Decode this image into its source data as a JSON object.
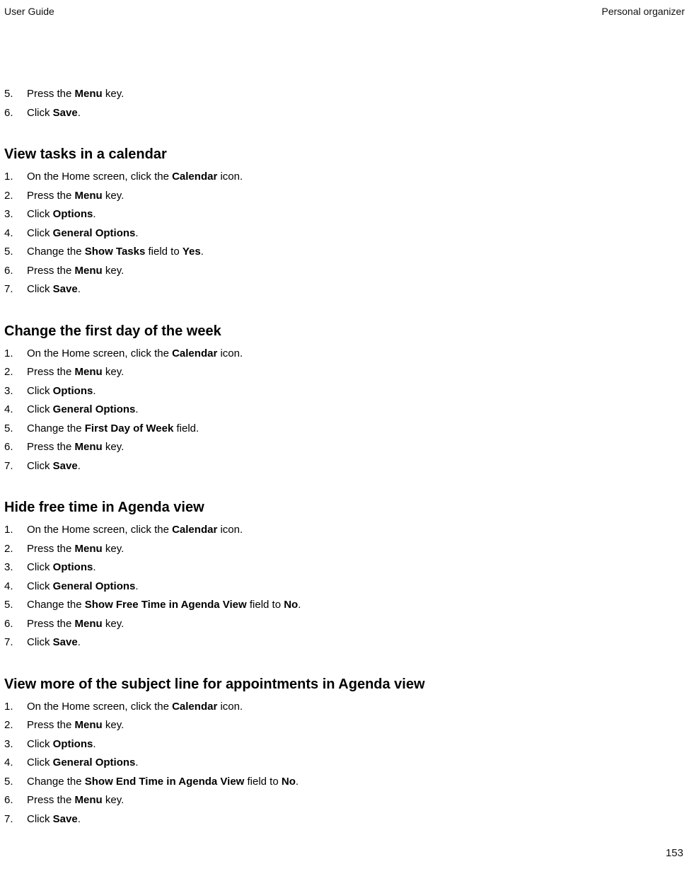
{
  "header": {
    "left": "User Guide",
    "right": "Personal organizer"
  },
  "intro_steps": [
    {
      "n": "5.",
      "parts": [
        {
          "t": "Press the "
        },
        {
          "b": "Menu"
        },
        {
          "t": " key."
        }
      ]
    },
    {
      "n": "6.",
      "parts": [
        {
          "t": "Click "
        },
        {
          "b": "Save"
        },
        {
          "t": "."
        }
      ]
    }
  ],
  "sections": [
    {
      "title": "View tasks in a calendar",
      "steps": [
        {
          "n": "1.",
          "parts": [
            {
              "t": "On the Home screen, click the "
            },
            {
              "b": "Calendar"
            },
            {
              "t": " icon."
            }
          ]
        },
        {
          "n": "2.",
          "parts": [
            {
              "t": "Press the "
            },
            {
              "b": "Menu"
            },
            {
              "t": " key."
            }
          ]
        },
        {
          "n": "3.",
          "parts": [
            {
              "t": "Click "
            },
            {
              "b": "Options"
            },
            {
              "t": "."
            }
          ]
        },
        {
          "n": "4.",
          "parts": [
            {
              "t": "Click "
            },
            {
              "b": "General Options"
            },
            {
              "t": "."
            }
          ]
        },
        {
          "n": "5.",
          "parts": [
            {
              "t": "Change the "
            },
            {
              "b": "Show Tasks"
            },
            {
              "t": " field to "
            },
            {
              "b": "Yes"
            },
            {
              "t": "."
            }
          ]
        },
        {
          "n": "6.",
          "parts": [
            {
              "t": "Press the "
            },
            {
              "b": "Menu"
            },
            {
              "t": " key."
            }
          ]
        },
        {
          "n": "7.",
          "parts": [
            {
              "t": "Click "
            },
            {
              "b": "Save"
            },
            {
              "t": "."
            }
          ]
        }
      ]
    },
    {
      "title": "Change the first day of the week",
      "steps": [
        {
          "n": "1.",
          "parts": [
            {
              "t": "On the Home screen, click the "
            },
            {
              "b": "Calendar"
            },
            {
              "t": " icon."
            }
          ]
        },
        {
          "n": "2.",
          "parts": [
            {
              "t": "Press the "
            },
            {
              "b": "Menu"
            },
            {
              "t": " key."
            }
          ]
        },
        {
          "n": "3.",
          "parts": [
            {
              "t": "Click "
            },
            {
              "b": "Options"
            },
            {
              "t": "."
            }
          ]
        },
        {
          "n": "4.",
          "parts": [
            {
              "t": "Click "
            },
            {
              "b": "General Options"
            },
            {
              "t": "."
            }
          ]
        },
        {
          "n": "5.",
          "parts": [
            {
              "t": "Change the "
            },
            {
              "b": "First Day of Week"
            },
            {
              "t": " field."
            }
          ]
        },
        {
          "n": "6.",
          "parts": [
            {
              "t": "Press the "
            },
            {
              "b": "Menu"
            },
            {
              "t": " key."
            }
          ]
        },
        {
          "n": "7.",
          "parts": [
            {
              "t": "Click "
            },
            {
              "b": "Save"
            },
            {
              "t": "."
            }
          ]
        }
      ]
    },
    {
      "title": "Hide free time in Agenda view",
      "steps": [
        {
          "n": "1.",
          "parts": [
            {
              "t": "On the Home screen, click the "
            },
            {
              "b": "Calendar"
            },
            {
              "t": " icon."
            }
          ]
        },
        {
          "n": "2.",
          "parts": [
            {
              "t": "Press the "
            },
            {
              "b": "Menu"
            },
            {
              "t": " key."
            }
          ]
        },
        {
          "n": "3.",
          "parts": [
            {
              "t": "Click "
            },
            {
              "b": "Options"
            },
            {
              "t": "."
            }
          ]
        },
        {
          "n": "4.",
          "parts": [
            {
              "t": "Click "
            },
            {
              "b": "General Options"
            },
            {
              "t": "."
            }
          ]
        },
        {
          "n": "5.",
          "parts": [
            {
              "t": "Change the "
            },
            {
              "b": "Show Free Time in Agenda View"
            },
            {
              "t": " field to "
            },
            {
              "b": "No"
            },
            {
              "t": "."
            }
          ]
        },
        {
          "n": "6.",
          "parts": [
            {
              "t": "Press the "
            },
            {
              "b": "Menu"
            },
            {
              "t": " key."
            }
          ]
        },
        {
          "n": "7.",
          "parts": [
            {
              "t": "Click "
            },
            {
              "b": "Save"
            },
            {
              "t": "."
            }
          ]
        }
      ]
    },
    {
      "title": "View more of the subject line for appointments in Agenda view",
      "steps": [
        {
          "n": "1.",
          "parts": [
            {
              "t": "On the Home screen, click the "
            },
            {
              "b": "Calendar"
            },
            {
              "t": " icon."
            }
          ]
        },
        {
          "n": "2.",
          "parts": [
            {
              "t": "Press the "
            },
            {
              "b": "Menu"
            },
            {
              "t": " key."
            }
          ]
        },
        {
          "n": "3.",
          "parts": [
            {
              "t": "Click "
            },
            {
              "b": "Options"
            },
            {
              "t": "."
            }
          ]
        },
        {
          "n": "4.",
          "parts": [
            {
              "t": "Click "
            },
            {
              "b": "General Options"
            },
            {
              "t": "."
            }
          ]
        },
        {
          "n": "5.",
          "parts": [
            {
              "t": "Change the "
            },
            {
              "b": "Show End Time in Agenda View"
            },
            {
              "t": " field to "
            },
            {
              "b": "No"
            },
            {
              "t": "."
            }
          ]
        },
        {
          "n": "6.",
          "parts": [
            {
              "t": "Press the "
            },
            {
              "b": "Menu"
            },
            {
              "t": " key."
            }
          ]
        },
        {
          "n": "7.",
          "parts": [
            {
              "t": "Click "
            },
            {
              "b": "Save"
            },
            {
              "t": "."
            }
          ]
        }
      ]
    }
  ],
  "page_number": "153"
}
